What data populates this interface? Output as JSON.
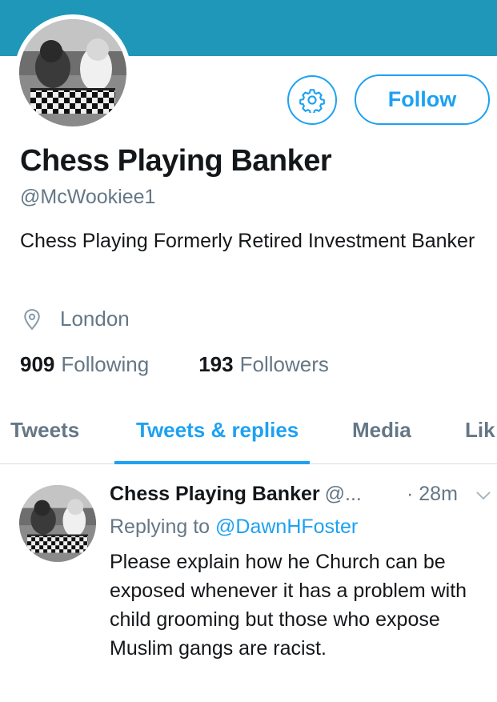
{
  "profile": {
    "display_name": "Chess Playing Banker",
    "handle": "@McWookiee1",
    "bio": "Chess Playing Formerly Retired Investment Banker",
    "location": "London",
    "following_count": "909",
    "following_label": "Following",
    "followers_count": "193",
    "followers_label": "Followers"
  },
  "actions": {
    "settings_icon": "gear-icon",
    "follow_label": "Follow"
  },
  "tabs": [
    {
      "label": "Tweets",
      "active": false
    },
    {
      "label": "Tweets & replies",
      "active": true
    },
    {
      "label": "Media",
      "active": false
    },
    {
      "label": "Lik",
      "active": false
    }
  ],
  "tweet": {
    "name": "Chess Playing Banker",
    "handle": "@...",
    "time": "· 28m",
    "replying_prefix": "Replying to ",
    "replying_to": "@DawnHFoster",
    "text": "Please explain how he Church can be exposed whenever it has a problem with child grooming but those who expose Muslim gangs are racist."
  },
  "colors": {
    "banner": "#1f97b8",
    "accent": "#1da1f2",
    "secondary_text": "#657786"
  }
}
